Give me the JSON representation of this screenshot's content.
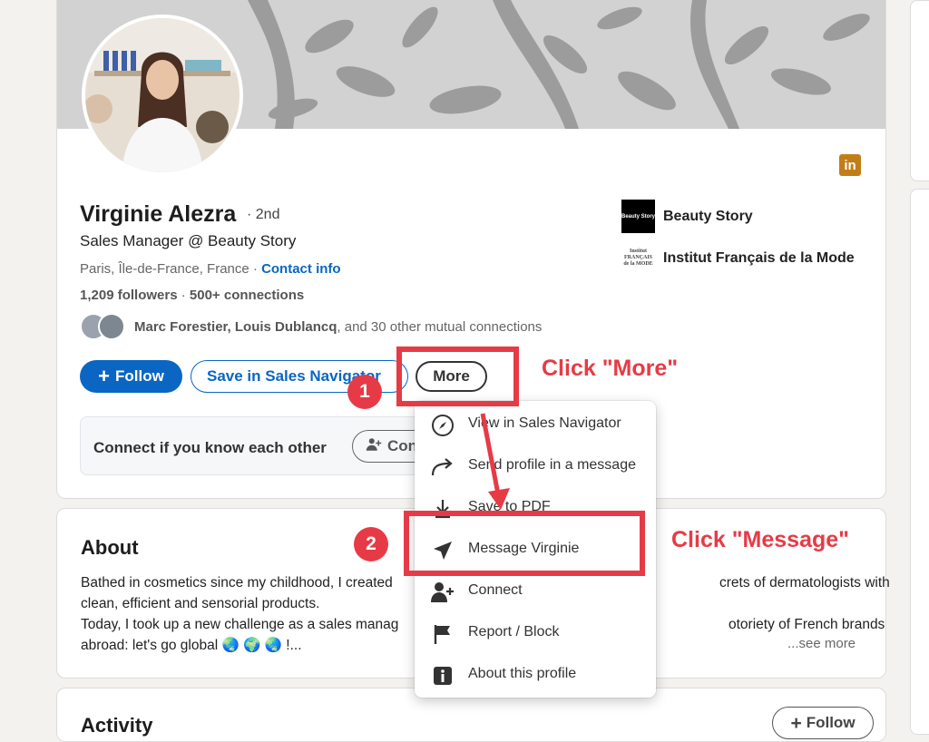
{
  "profile": {
    "name": "Virginie Alezra",
    "degree": "· 2nd",
    "headline": "Sales Manager @ Beauty Story",
    "location": "Paris, Île-de-France, France · ",
    "contact_info": "Contact info",
    "followers": "1,209 followers",
    "connections_sep": " · ",
    "connections": "500+ connections",
    "mutual_names": "Marc Forestier, Louis Dublancq",
    "mutual_rest": ", and 30 other mutual connections",
    "linkedin_badge": "in"
  },
  "companies": [
    {
      "name": "Beauty Story",
      "logo_text": "Beauty Story"
    },
    {
      "name": "Institut Français de la Mode",
      "logo_text": "Institut FRANÇAIS de la MODE"
    }
  ],
  "actions": {
    "follow": "Follow",
    "save_sales_nav": "Save in Sales Navigator",
    "more": "More"
  },
  "connect_box": {
    "text": "Connect if you know each other",
    "button": "Con"
  },
  "menu": [
    {
      "label": "View in Sales Navigator",
      "icon": "compass-icon"
    },
    {
      "label": "Send profile in a message",
      "icon": "share-arrow-icon"
    },
    {
      "label": "Save to PDF",
      "icon": "download-icon"
    },
    {
      "label": "Message Virginie",
      "icon": "send-icon"
    },
    {
      "label": "Connect",
      "icon": "add-person-icon"
    },
    {
      "label": "Report / Block",
      "icon": "flag-icon"
    },
    {
      "label": "About this profile",
      "icon": "info-icon"
    }
  ],
  "about": {
    "title": "About",
    "line1": "Bathed in cosmetics since my childhood, I created",
    "line1_end": "crets of dermatologists with",
    "line2": "clean, efficient and sensorial products.",
    "line3": "Today, I took up a new challenge as a sales manag",
    "line3_end": "otoriety of French brands",
    "line4": "abroad: let's go global 🌏 🌍 🌏 !...",
    "see_more": "...see more"
  },
  "activity": {
    "title": "Activity",
    "follow": "Follow"
  },
  "annotations": {
    "step1": "1",
    "step2": "2",
    "click_more": "Click \"More\"",
    "click_message": "Click \"Message\""
  },
  "colors": {
    "accent": "#0a66c2",
    "annotation": "#e63b46",
    "linkedin_badge": "#c37d16"
  }
}
